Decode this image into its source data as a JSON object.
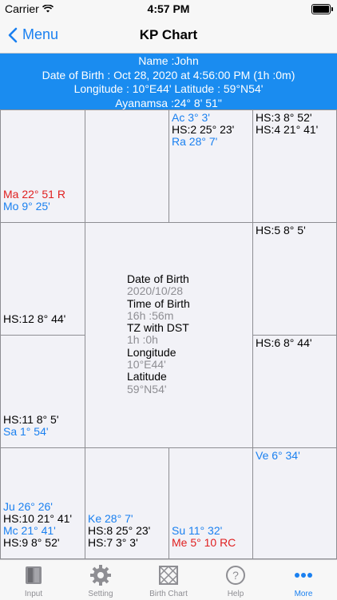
{
  "status_bar": {
    "carrier": "Carrier",
    "time": "4:57 PM"
  },
  "nav": {
    "back_label": "Menu",
    "title": "KP Chart"
  },
  "header": {
    "line1": "Name :John",
    "line2": "Date of Birth : Oct 28, 2020 at 4:56:00 PM (1h :0m)",
    "line3": "Longitude : 10°E44' Latitude : 59°N54'",
    "line4": "Ayanamsa :24° 8' 51\""
  },
  "houses": {
    "h12": [
      {
        "t": "Ma 22° 51 R",
        "c": "red"
      },
      {
        "t": "Mo 9° 25'",
        "c": "blue"
      }
    ],
    "h1": [],
    "h2": [
      {
        "t": "Ac 3° 3'",
        "c": "blue"
      },
      {
        "t": "HS:2 25° 23'",
        "c": "black"
      },
      {
        "t": "Ra 28° 7'",
        "c": "blue"
      }
    ],
    "h3": [
      {
        "t": "HS:3 8° 52'",
        "c": "black"
      },
      {
        "t": "HS:4 21° 41'",
        "c": "black"
      }
    ],
    "h11": [
      {
        "t": "HS:12 8° 44'",
        "c": "black"
      }
    ],
    "h5": [
      {
        "t": "HS:5 8° 5'",
        "c": "black"
      }
    ],
    "h10": [
      {
        "t": "HS:11 8° 5'",
        "c": "black"
      },
      {
        "t": "Sa 1° 54'",
        "c": "blue"
      }
    ],
    "h6": [
      {
        "t": "HS:6 8° 44'",
        "c": "black"
      }
    ],
    "h9": [
      {
        "t": "Ju 26° 26'",
        "c": "blue"
      },
      {
        "t": "HS:10 21° 41'",
        "c": "black"
      },
      {
        "t": "Mc 21° 41'",
        "c": "blue"
      },
      {
        "t": "HS:9 8° 52'",
        "c": "black"
      }
    ],
    "h8": [
      {
        "t": "Ke 28° 7'",
        "c": "blue"
      },
      {
        "t": "HS:8 25° 23'",
        "c": "black"
      },
      {
        "t": "HS:7 3° 3'",
        "c": "black"
      }
    ],
    "h7b": [
      {
        "t": "Su 11° 32'",
        "c": "blue"
      },
      {
        "t": "Me 5° 10 RC",
        "c": "red"
      }
    ],
    "h7": [
      {
        "t": "Ve 6° 34'",
        "c": "blue"
      }
    ]
  },
  "center": {
    "dob_label": "Date of Birth",
    "dob_value": "2020/10/28",
    "tob_label": "Time of Birth",
    "tob_value": "16h :56m",
    "tz_label": "TZ with DST",
    "tz_value": "1h :0h",
    "lon_label": "Longitude",
    "lon_value": "10°E44'",
    "lat_label": "Latitude",
    "lat_value": "59°N54'"
  },
  "tabs": [
    {
      "label": "Input",
      "icon": "book-icon"
    },
    {
      "label": "Setting",
      "icon": "gear-icon"
    },
    {
      "label": "Birth Chart",
      "icon": "chart-grid-icon"
    },
    {
      "label": "Help",
      "icon": "help-icon"
    },
    {
      "label": "More",
      "icon": "more-icon",
      "active": true
    }
  ],
  "colors": {
    "accent": "#1a80f0",
    "header_bg": "#1a8cf0",
    "red": "#e02020"
  }
}
